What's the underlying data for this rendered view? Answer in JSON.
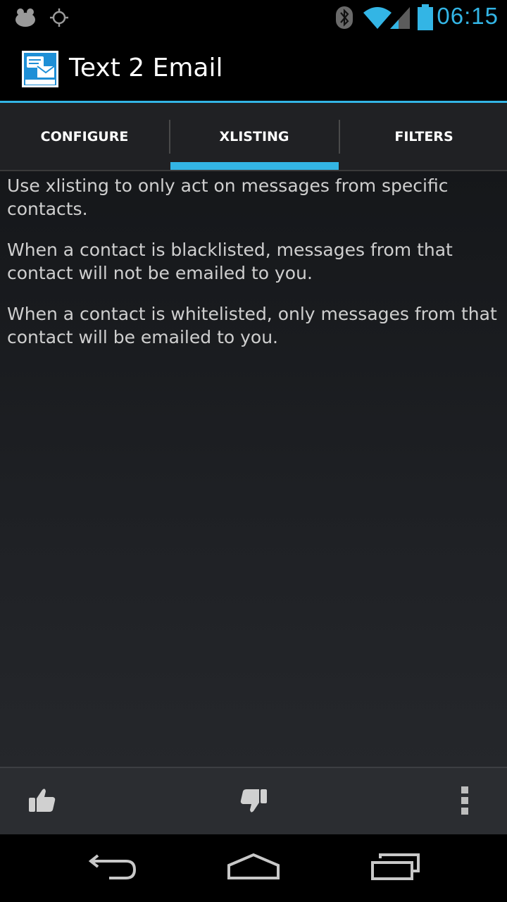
{
  "status_bar": {
    "time": "06:15",
    "icons": [
      "notification-blob-icon",
      "gps-icon",
      "bluetooth-icon",
      "wifi-icon",
      "cell-signal-icon",
      "battery-icon"
    ],
    "accent_color": "#33b5e5"
  },
  "action_bar": {
    "title": "Text 2 Email",
    "logo_icon": "text2email-logo-icon"
  },
  "tabs": [
    {
      "label": "CONFIGURE",
      "selected": false
    },
    {
      "label": "XLISTING",
      "selected": true
    },
    {
      "label": "FILTERS",
      "selected": false
    }
  ],
  "content": {
    "paragraphs": [
      "Use xlisting to only act on messages from specific contacts.",
      "When a contact is blacklisted, messages from that contact will not be emailed to you.",
      "When a contact is whitelisted, only messages from that contact will be emailed to you."
    ]
  },
  "split_action_bar": {
    "icons": [
      "thumbs-up-icon",
      "thumbs-down-icon",
      "overflow-menu-icon"
    ]
  },
  "nav_bar": {
    "icons": [
      "back-icon",
      "home-icon",
      "recent-apps-icon"
    ]
  }
}
